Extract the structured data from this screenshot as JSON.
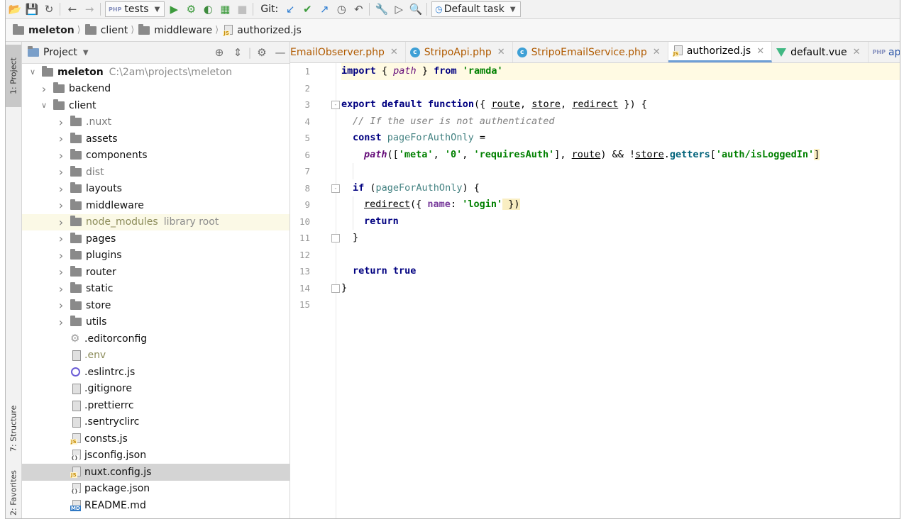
{
  "toolbar": {
    "run_config": "tests",
    "git_label": "Git:",
    "task_combo": "Default task"
  },
  "breadcrumb": [
    "meleton",
    "client",
    "middleware",
    "authorized.js"
  ],
  "strip": {
    "project_tab": "1: Project",
    "structure_tab": "7: Structure",
    "favorites_tab": "2: Favorites"
  },
  "panel": {
    "title": "Project",
    "root_name": "meleton",
    "root_path": "C:\\2am\\projects\\meleton",
    "items": [
      {
        "label": "backend",
        "kind": "folder",
        "depth": 1,
        "expanded": false
      },
      {
        "label": "client",
        "kind": "folder",
        "depth": 1,
        "expanded": true
      },
      {
        "label": ".nuxt",
        "kind": "folder",
        "depth": 2,
        "style": "gray"
      },
      {
        "label": "assets",
        "kind": "folder",
        "depth": 2
      },
      {
        "label": "components",
        "kind": "folder",
        "depth": 2
      },
      {
        "label": "dist",
        "kind": "folder",
        "depth": 2,
        "style": "gray"
      },
      {
        "label": "layouts",
        "kind": "folder",
        "depth": 2
      },
      {
        "label": "middleware",
        "kind": "folder",
        "depth": 2
      },
      {
        "label": "node_modules",
        "kind": "folder",
        "depth": 2,
        "style": "olive",
        "hint": "library root"
      },
      {
        "label": "pages",
        "kind": "folder",
        "depth": 2
      },
      {
        "label": "plugins",
        "kind": "folder",
        "depth": 2
      },
      {
        "label": "router",
        "kind": "folder",
        "depth": 2
      },
      {
        "label": "static",
        "kind": "folder",
        "depth": 2
      },
      {
        "label": "store",
        "kind": "folder",
        "depth": 2
      },
      {
        "label": "utils",
        "kind": "folder",
        "depth": 2
      },
      {
        "label": ".editorconfig",
        "kind": "gear",
        "depth": 2
      },
      {
        "label": ".env",
        "kind": "doc",
        "depth": 2,
        "style": "olive"
      },
      {
        "label": ".eslintrc.js",
        "kind": "eslint",
        "depth": 2
      },
      {
        "label": ".gitignore",
        "kind": "doc",
        "depth": 2
      },
      {
        "label": ".prettierrc",
        "kind": "doc",
        "depth": 2
      },
      {
        "label": ".sentryclirc",
        "kind": "doc",
        "depth": 2
      },
      {
        "label": "consts.js",
        "kind": "js",
        "depth": 2
      },
      {
        "label": "jsconfig.json",
        "kind": "json",
        "depth": 2
      },
      {
        "label": "nuxt.config.js",
        "kind": "js",
        "depth": 2,
        "selected": true
      },
      {
        "label": "package.json",
        "kind": "json",
        "depth": 2
      },
      {
        "label": "README.md",
        "kind": "md",
        "depth": 2
      }
    ]
  },
  "tabs": [
    {
      "label": "EmailObserver.php",
      "icon": "none",
      "color": "orange"
    },
    {
      "label": "StripoApi.php",
      "icon": "c",
      "color": "orange"
    },
    {
      "label": "StripoEmailService.php",
      "icon": "c",
      "color": "orange"
    },
    {
      "label": "authorized.js",
      "icon": "js",
      "color": "normal",
      "active": true
    },
    {
      "label": "default.vue",
      "icon": "vue",
      "color": "normal"
    },
    {
      "label": "app.php",
      "icon": "php",
      "color": "blue"
    }
  ],
  "code": {
    "line_numbers": [
      "1",
      "2",
      "3",
      "4",
      "5",
      "6",
      "7",
      "8",
      "9",
      "10",
      "11",
      "12",
      "13",
      "14",
      "15"
    ],
    "l1": {
      "import": "import",
      "b1": " { ",
      "path": "path",
      "b2": " } ",
      "from": "from",
      "sp": " ",
      "mod": "'ramda'"
    },
    "l3": {
      "export": "export",
      "default": "default",
      "function": "function",
      "open": "({ ",
      "route": "route",
      "c1": ", ",
      "store": "store",
      "c2": ", ",
      "redirect": "redirect",
      "close": " }) {"
    },
    "l4": "// If the user is not authenticated",
    "l5": {
      "const": "const",
      "name": "pageForAuthOnly",
      "eq": " ="
    },
    "l6": {
      "path": "path",
      "a": "([",
      "meta": "'meta'",
      "c1": ", ",
      "zero": "'0'",
      "c2": ", ",
      "req": "'requiresAuth'",
      "b": "], ",
      "route": "route",
      "c": ") && !",
      "store": "store",
      "dot": ".",
      "getters": "getters",
      "ob": "[",
      "key": "'auth/isLoggedIn'",
      "cb": "]"
    },
    "l8": {
      "if": "if",
      "open": " (",
      "name": "pageForAuthOnly",
      "close": ") {"
    },
    "l9": {
      "redirect": "redirect",
      "open": "({ ",
      "prop": "name",
      "colon": ": ",
      "val": "'login'",
      "close": " })"
    },
    "l10": "return",
    "l11": "}",
    "l13": {
      "return": "return",
      "true": "true"
    },
    "l14": "}"
  }
}
